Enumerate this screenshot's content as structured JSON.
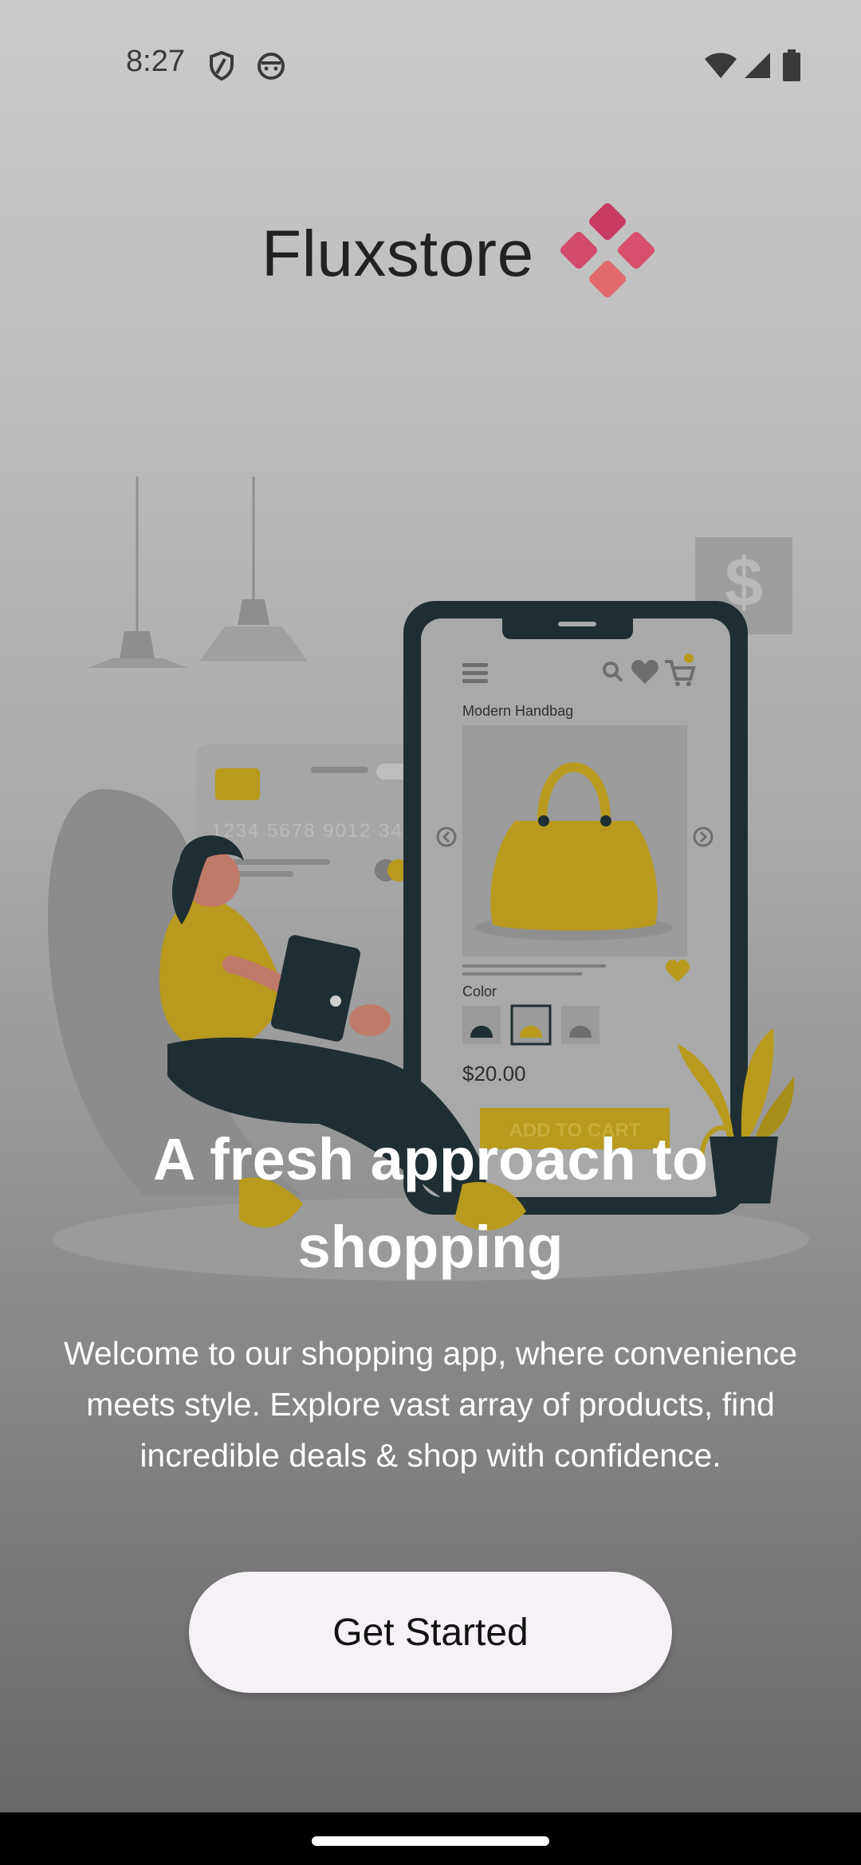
{
  "status_bar": {
    "time": "8:27",
    "left_icons": [
      "shield-icon",
      "android-face-icon"
    ],
    "right_icons": [
      "wifi-icon",
      "cellular-signal-icon",
      "battery-icon"
    ]
  },
  "brand": {
    "name": "Fluxstore",
    "logo_color": "#d44a6a"
  },
  "illustration": {
    "screen_title": "Modern Handbag",
    "card_number": "1234 5678 9012 345",
    "color_label": "Color",
    "price": "$20.00",
    "button_label": "ADD TO CART",
    "currency_sign": "$",
    "cart_badge": "1"
  },
  "onboarding": {
    "headline_line1": "A fresh approach to",
    "headline_line2": "shopping",
    "description": "Welcome to our shopping app, where convenience meets style. Explore vast array of products, find incredible deals & shop with confidence.",
    "cta_label": "Get Started"
  },
  "colors": {
    "accent_yellow": "#d4b020",
    "dark_teal": "#1f2e33",
    "brand_pink": "#d44a6a",
    "button_bg": "#f6f0f7"
  }
}
